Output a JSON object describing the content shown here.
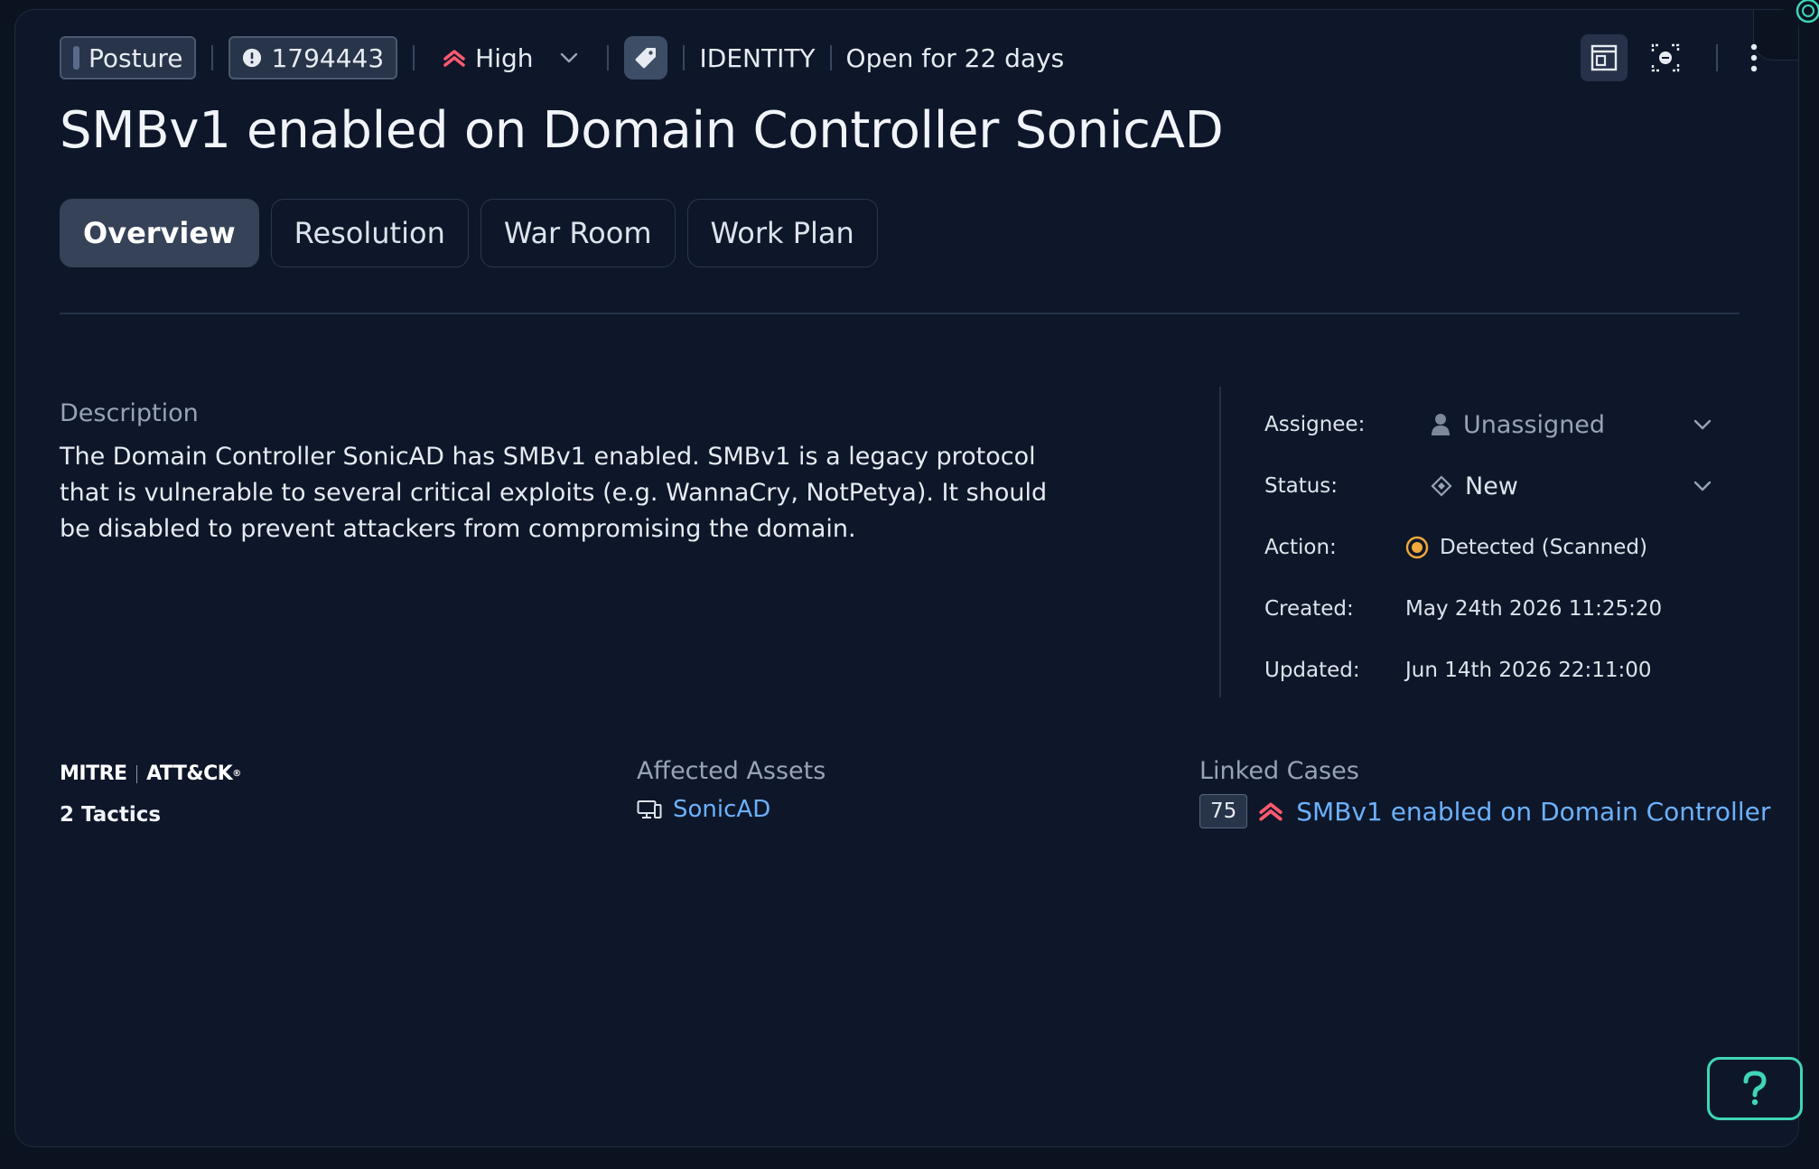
{
  "header": {
    "category_chip": "Posture",
    "alert_id": "1794443",
    "severity": "High",
    "source": "IDENTITY",
    "open_duration": "Open for 22 days"
  },
  "title": "SMBv1 enabled on Domain Controller SonicAD",
  "tabs": [
    {
      "label": "Overview",
      "active": true
    },
    {
      "label": "Resolution",
      "active": false
    },
    {
      "label": "War Room",
      "active": false
    },
    {
      "label": "Work Plan",
      "active": false
    }
  ],
  "description": {
    "label": "Description",
    "text": "The Domain Controller SonicAD has SMBv1 enabled. SMBv1 is a legacy protocol that is vulnerable to several critical exploits (e.g. WannaCry, NotPetya). It should be disabled to prevent attackers from compromising the domain."
  },
  "properties": {
    "assignee_label": "Assignee:",
    "assignee_value": "Unassigned",
    "status_label": "Status:",
    "status_value": "New",
    "action_label": "Action:",
    "action_value": "Detected (Scanned)",
    "created_label": "Created:",
    "created_value": "May 24th 2026 11:25:20",
    "updated_label": "Updated:",
    "updated_value": "Jun 14th 2026 22:11:00"
  },
  "mitre": {
    "logo_left": "MITRE",
    "logo_right": "ATT&CK",
    "tactics": "2 Tactics"
  },
  "affected_assets": {
    "label": "Affected Assets",
    "asset": "SonicAD"
  },
  "linked_cases": {
    "label": "Linked Cases",
    "case_id": "75",
    "case_title": "SMBv1 enabled on Domain Controller"
  },
  "help": {
    "label": "?"
  },
  "colors": {
    "background": "#0e1729",
    "severity_high": "#ff5a6e",
    "link": "#6cb1ff",
    "action_detected": "#f0a93a",
    "help_accent": "#3fd6b6"
  },
  "icons": [
    "warning-icon",
    "severity-up-icon",
    "chevron-down-icon",
    "tag-icon",
    "layout-panel-icon",
    "focus-icon",
    "more-vertical-icon",
    "user-icon",
    "status-diamond-icon",
    "detected-dot-icon",
    "computer-icon",
    "help-icon",
    "brand-logo-icon"
  ]
}
